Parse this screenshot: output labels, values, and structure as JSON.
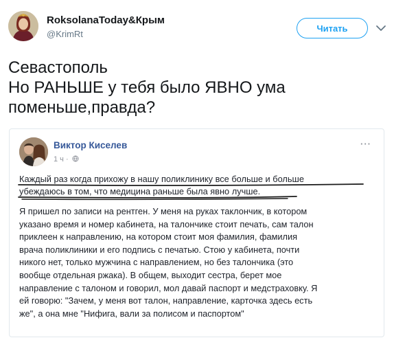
{
  "tweet": {
    "display_name": "RoksolanaToday&Крым",
    "handle": "@KrimRt",
    "follow_label": "Читать",
    "text_lines": [
      "Севастополь",
      "Но РАНЬШЕ у тебя было ЯВНО ума",
      "поменьше,правда?"
    ]
  },
  "fb_post": {
    "author": "Виктор Киселев",
    "time": "1 ч ·",
    "more_label": "···",
    "highlight_lines": [
      "Каждый раз когда прихожу в нашу поликлинику все больше и больше",
      "убеждаюсь в том, что медицина раньше была явно лучше."
    ],
    "body_lines": [
      "Я пришел по записи на рентген. У меня на руках таклончик, в котором",
      "указано время и номер кабинета, на талончике стоит печать, сам талон",
      "приклеен к направлению, на котором стоит моя фамилия, фамилия",
      "врача поликлиники и его подпись с печатью. Стою у кабинета, почти",
      "никого нет, только мужчина с направлением, но без талончика (это",
      "вообще отдельная ржака). В общем, выходит сестра, берет мое",
      "направление с талоном и говорил, мол давай паспорт и медстраховку. Я",
      "ей говорю: \"Зачем, у меня вот талон, направление, карточка здесь есть",
      "же\", а она мне \"Нифига, вали за полисом и паспортом\""
    ]
  },
  "colors": {
    "accent": "#1da1f2",
    "fb_name": "#365899",
    "underline": "#1a1a1a"
  },
  "icons": {
    "chevron": "chevron-down-icon",
    "globe": "globe-icon"
  }
}
